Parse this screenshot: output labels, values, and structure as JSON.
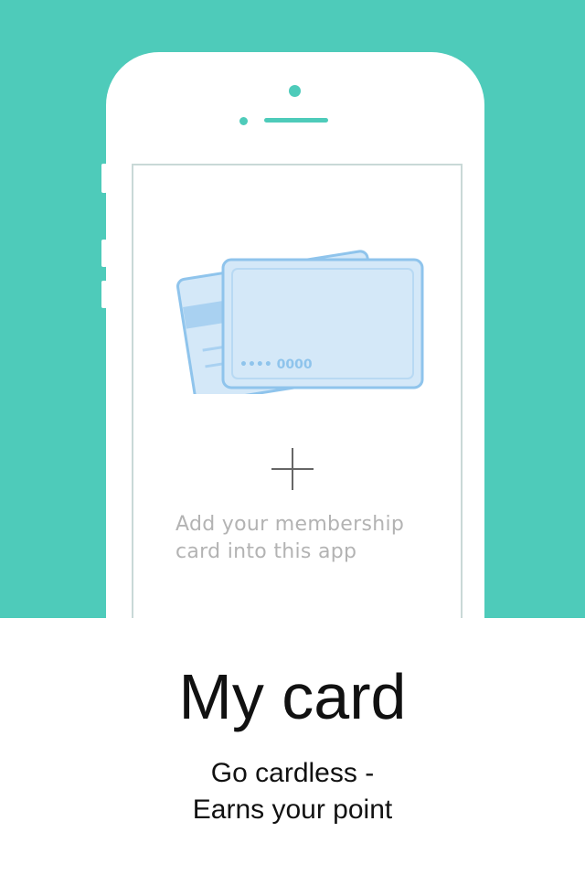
{
  "colors": {
    "accent": "#4ecbba",
    "card_stroke": "#8fc4ec",
    "card_fill": "#d4e8f8",
    "caption": "#b3b3b3",
    "plus": "#666666"
  },
  "phone": {
    "add_icon": "plus-icon",
    "illustration": "membership-cards",
    "card_number": "•••• 0000",
    "add_caption_line1": "Add your membership",
    "add_caption_line2": "card into this app"
  },
  "feature": {
    "title": "My card",
    "subtitle_line1": "Go cardless -",
    "subtitle_line2": "Earns your point"
  }
}
